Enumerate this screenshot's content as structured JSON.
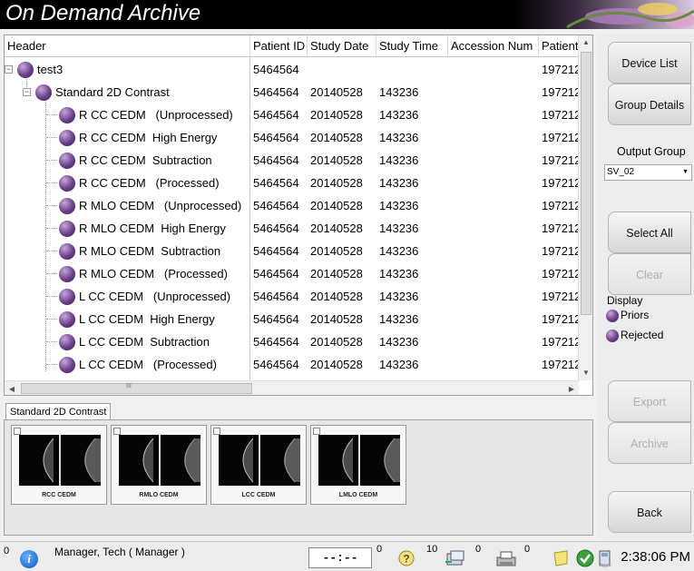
{
  "window": {
    "title": "On Demand Archive"
  },
  "grid": {
    "columns": [
      "Header",
      "Patient ID",
      "Study Date",
      "Study Time",
      "Accession Num",
      "Patient"
    ],
    "rows": [
      {
        "label": "test3",
        "patient_id": "5464564",
        "study_date": "",
        "study_time": "",
        "accession": "",
        "patient": "197212"
      },
      {
        "label": "Standard 2D Contrast",
        "patient_id": "5464564",
        "study_date": "20140528",
        "study_time": "143236",
        "accession": "",
        "patient": "197212"
      },
      {
        "label": "R CC CEDM   (Unprocessed)",
        "patient_id": "5464564",
        "study_date": "20140528",
        "study_time": "143236",
        "accession": "",
        "patient": "197212"
      },
      {
        "label": "R CC CEDM  High Energy",
        "patient_id": "5464564",
        "study_date": "20140528",
        "study_time": "143236",
        "accession": "",
        "patient": "197212"
      },
      {
        "label": "R CC CEDM  Subtraction",
        "patient_id": "5464564",
        "study_date": "20140528",
        "study_time": "143236",
        "accession": "",
        "patient": "197212"
      },
      {
        "label": "R CC CEDM   (Processed)",
        "patient_id": "5464564",
        "study_date": "20140528",
        "study_time": "143236",
        "accession": "",
        "patient": "197212"
      },
      {
        "label": "R MLO CEDM   (Unprocessed)",
        "patient_id": "5464564",
        "study_date": "20140528",
        "study_time": "143236",
        "accession": "",
        "patient": "197212"
      },
      {
        "label": "R MLO CEDM  High Energy",
        "patient_id": "5464564",
        "study_date": "20140528",
        "study_time": "143236",
        "accession": "",
        "patient": "197212"
      },
      {
        "label": "R MLO CEDM  Subtraction",
        "patient_id": "5464564",
        "study_date": "20140528",
        "study_time": "143236",
        "accession": "",
        "patient": "197212"
      },
      {
        "label": "R MLO CEDM   (Processed)",
        "patient_id": "5464564",
        "study_date": "20140528",
        "study_time": "143236",
        "accession": "",
        "patient": "197212"
      },
      {
        "label": "L CC CEDM   (Unprocessed)",
        "patient_id": "5464564",
        "study_date": "20140528",
        "study_time": "143236",
        "accession": "",
        "patient": "197212"
      },
      {
        "label": "L CC CEDM  High Energy",
        "patient_id": "5464564",
        "study_date": "20140528",
        "study_time": "143236",
        "accession": "",
        "patient": "197212"
      },
      {
        "label": "L CC CEDM  Subtraction",
        "patient_id": "5464564",
        "study_date": "20140528",
        "study_time": "143236",
        "accession": "",
        "patient": "197212"
      },
      {
        "label": "L CC CEDM   (Processed)",
        "patient_id": "5464564",
        "study_date": "20140528",
        "study_time": "143236",
        "accession": "",
        "patient": "197212"
      }
    ],
    "hscroll_marker": "III"
  },
  "thumbnails": {
    "tab_label": "Standard 2D Contrast",
    "items": [
      {
        "caption": "RCC CEDM"
      },
      {
        "caption": "RMLO CEDM"
      },
      {
        "caption": "LCC CEDM"
      },
      {
        "caption": "LMLO CEDM"
      }
    ]
  },
  "right_panel": {
    "device_list": "Device List",
    "group_details": "Group Details",
    "output_group_label": "Output Group",
    "output_group_value": "SV_02",
    "select_all": "Select All",
    "clear": "Clear",
    "display_label": "Display",
    "priors": "Priors",
    "rejected": "Rejected",
    "export": "Export",
    "archive": "Archive",
    "back": "Back"
  },
  "status": {
    "left_count": "0",
    "user": "Manager, Tech ( Manager )",
    "clock_placeholder": "--:--",
    "count_a": "0",
    "count_b": "10",
    "count_c": "0",
    "count_d": "0",
    "time": "2:38:06 PM"
  },
  "colors": {
    "accent_purple": "#6a3f8a",
    "title_bg": "#000000"
  }
}
